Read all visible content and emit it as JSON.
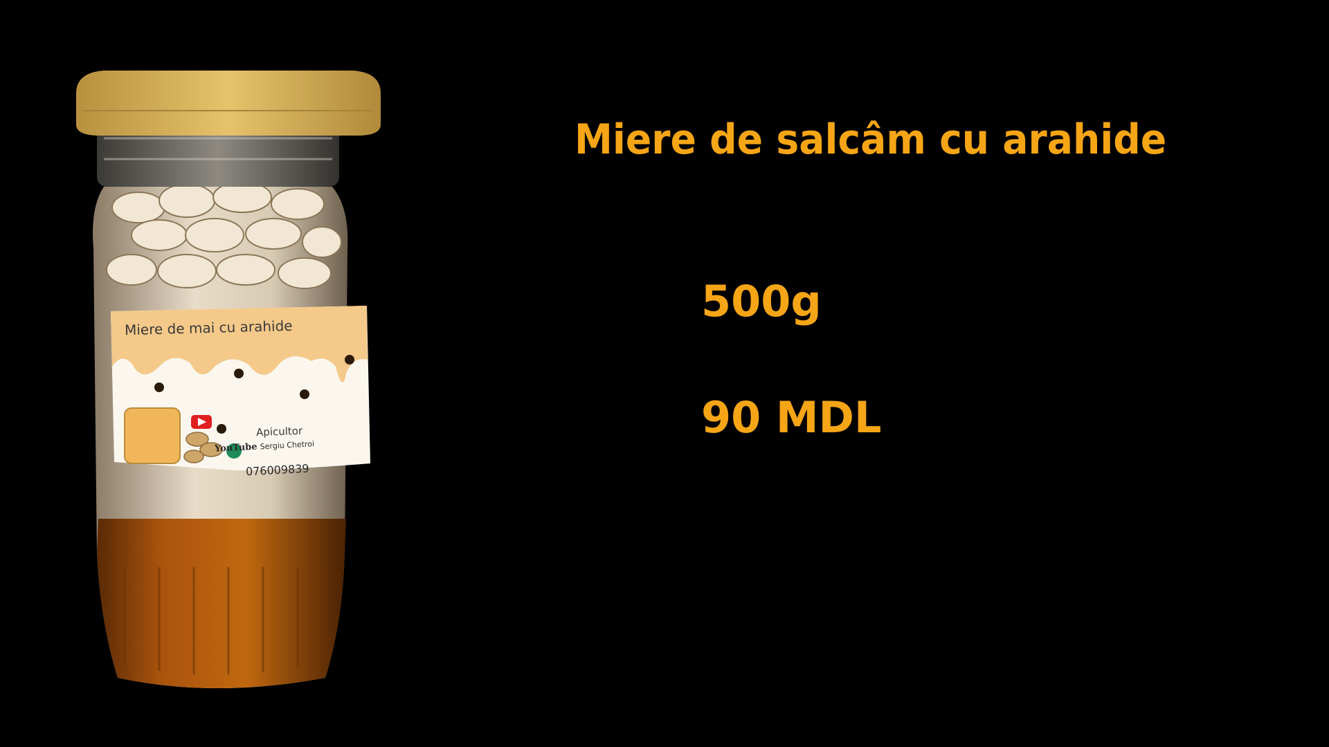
{
  "product": {
    "title": "Miere de salcâm cu arahide",
    "weight": "500g",
    "price": "90 MDL"
  },
  "jar_label": {
    "name": "Miere de mai cu arahide",
    "producer": "Apicultor",
    "channel_brand": "YouTube",
    "channel_name": "Sergiu Chetroi",
    "phone": "076009839"
  },
  "colors": {
    "background": "#000000",
    "accent_text": "#f5a516",
    "lid": "#d9b25c",
    "honey": "#a8520d"
  }
}
